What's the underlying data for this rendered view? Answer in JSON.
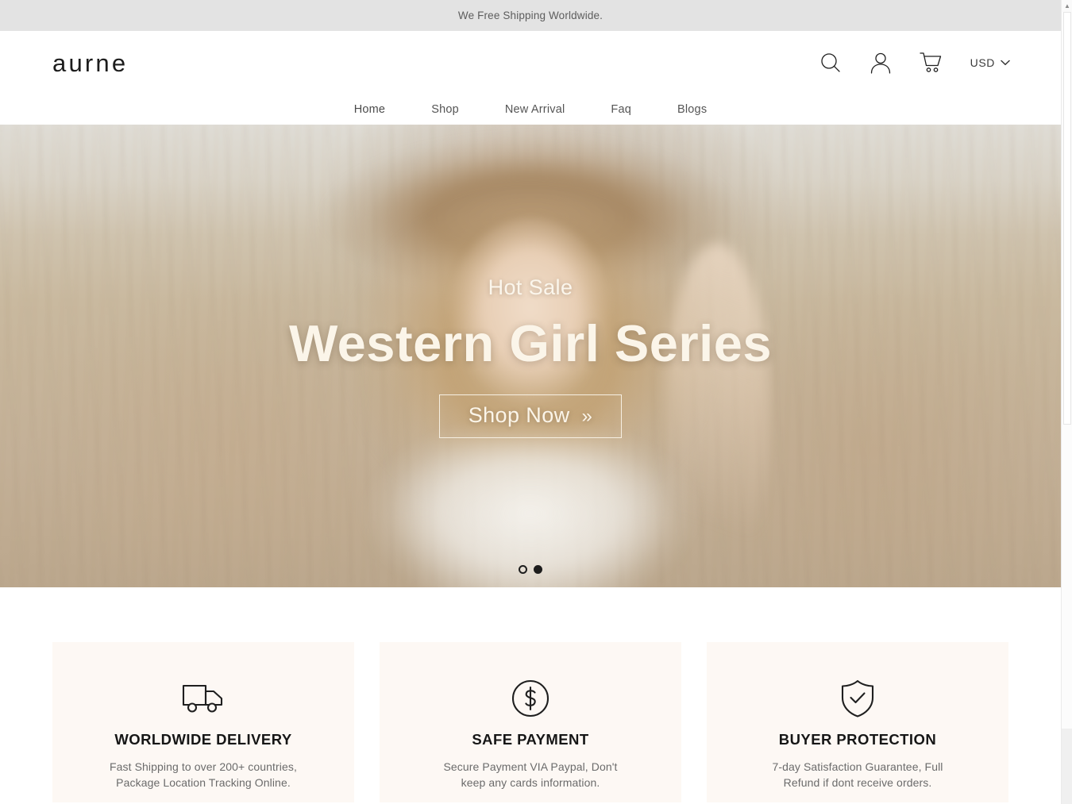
{
  "announcement": {
    "text": "We Free Shipping Worldwide."
  },
  "header": {
    "logo": "aurne",
    "icons": {
      "search": "search-icon",
      "account": "user-icon",
      "cart": "cart-icon",
      "chevron": "chevron-down-icon"
    },
    "currency": {
      "selected": "USD"
    },
    "nav": [
      {
        "label": "Home"
      },
      {
        "label": "Shop"
      },
      {
        "label": "New Arrival"
      },
      {
        "label": "Faq"
      },
      {
        "label": "Blogs"
      }
    ]
  },
  "hero": {
    "eyebrow": "Hot Sale",
    "title": "Western Girl Series",
    "cta_label": "Shop Now",
    "cta_chevron": "»",
    "slides": [
      {
        "active": false
      },
      {
        "active": true
      }
    ],
    "colors": {
      "text": "#fbf5e9",
      "background": "#c6b49a"
    }
  },
  "features": [
    {
      "icon": "truck-icon",
      "title": "WORLDWIDE DELIVERY",
      "line1": "Fast Shipping to over 200+ countries,",
      "line2": "Package Location Tracking Online."
    },
    {
      "icon": "dollar-circle-icon",
      "title": "SAFE PAYMENT",
      "line1": "Secure Payment VIA Paypal, Don't",
      "line2": "keep any cards information."
    },
    {
      "icon": "shield-check-icon",
      "title": "BUYER PROTECTION",
      "line1": "7-day Satisfaction Guarantee, Full",
      "line2": "Refund if dont receive orders."
    }
  ],
  "scrollbar": {
    "up_arrow": "▲"
  },
  "theme": {
    "announce_bg": "#e3e3e3",
    "card_bg": "#fdf8f4",
    "ink": "#161616"
  }
}
